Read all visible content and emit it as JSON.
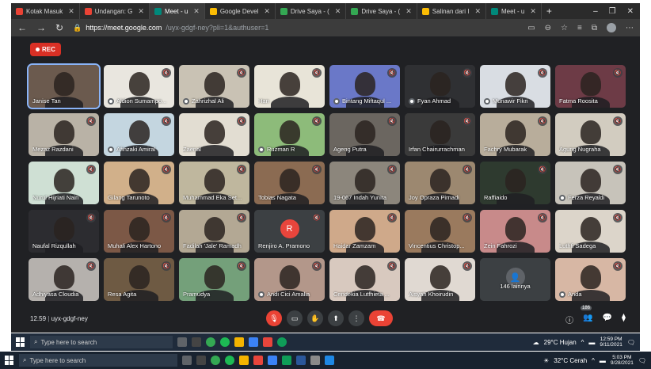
{
  "browser": {
    "tabs": [
      {
        "label": "Kotak Masuk",
        "color": "#ea4335"
      },
      {
        "label": "Undangan: G",
        "color": "#ea4335"
      },
      {
        "label": "Meet - u",
        "color": "#00897b",
        "active": true
      },
      {
        "label": "Google Devel",
        "color": "#fbbc04"
      },
      {
        "label": "Drive Saya - (",
        "color": "#34a853"
      },
      {
        "label": "Drive Saya - (",
        "color": "#34a853"
      },
      {
        "label": "Salinan dari I",
        "color": "#fbbc04"
      },
      {
        "label": "Meet - u",
        "color": "#00897b"
      }
    ],
    "url_host": "https://meet.google.com",
    "url_path": "/uyx-gdgf-ney?pli=1&authuser=1"
  },
  "meet": {
    "rec_label": "REC",
    "participants": [
      {
        "name": "Janise Tan",
        "color": "#6b5a4e",
        "active": true
      },
      {
        "name": "Aldion Sumampo...",
        "color": "#e9e6df",
        "pin": true
      },
      {
        "name": "Zahrizhal Ali",
        "color": "#c9c2b4",
        "pin": true
      },
      {
        "name": "Han",
        "color": "#e8e4d8"
      },
      {
        "name": "Bintang Miftaqul ...",
        "color": "#6a78c8",
        "pin": true
      },
      {
        "name": "Fyan Ahmad",
        "color": "#2f3033",
        "pin": true
      },
      {
        "name": "Munawir Fikri",
        "color": "#d9dde3",
        "pin": true
      },
      {
        "name": "Fatma Roosita",
        "color": "#6d3b46"
      },
      {
        "name": "Mezaz Razdani",
        "color": "#b9b2a6"
      },
      {
        "name": "Afinzaki Amiral",
        "color": "#c4d6e0",
        "pin": true
      },
      {
        "name": "Zaenal",
        "color": "#e2ddd2"
      },
      {
        "name": "Ruzman R",
        "color": "#8dbb7a",
        "pin": true
      },
      {
        "name": "Ageng Putra",
        "color": "#6b6660"
      },
      {
        "name": "Irfan Chairurrachman",
        "color": "#3a3a3a"
      },
      {
        "name": "Fachry Mubarak",
        "color": "#b8ad9b"
      },
      {
        "name": "Agung Nugraha",
        "color": "#d2ccc0"
      },
      {
        "name": "Nurul Hijriati Nain",
        "color": "#cfe0d4"
      },
      {
        "name": "Gilang Tarunoto",
        "color": "#d1b08a"
      },
      {
        "name": "Muhammad Eka Set...",
        "color": "#bfb79e"
      },
      {
        "name": "Tobias Nagata",
        "color": "#8b6b52"
      },
      {
        "name": "19-067 Indah Yunita",
        "color": "#8c867c"
      },
      {
        "name": "Joy Opraza Pirnadi",
        "color": "#9c8870"
      },
      {
        "name": "Raffiaido",
        "color": "#2e3a2f"
      },
      {
        "name": "Ferza Reyaldi",
        "color": "#c7c3ba",
        "pin": true
      },
      {
        "name": "Naufal Rizqullah",
        "color": "#2c2c30"
      },
      {
        "name": "Muhali Alex Hartono",
        "color": "#7c5846"
      },
      {
        "name": "Fadilah 'Jale' Ramadh",
        "color": "#b3a894"
      },
      {
        "name": "Renjiro A. Pramono",
        "color": "#3c4043",
        "avatar": "R"
      },
      {
        "name": "Haidar Zamzam",
        "color": "#cfa98a"
      },
      {
        "name": "Vincentius Christop...",
        "color": "#9a7a5e"
      },
      {
        "name": "Zein Fahrozi",
        "color": "#c88a8a"
      },
      {
        "name": "Luthfi Sadega",
        "color": "#dcd5ca"
      },
      {
        "name": "Adhiyasa Cloudia",
        "color": "#b5b1ad"
      },
      {
        "name": "Resa Agita",
        "color": "#6e5a43"
      },
      {
        "name": "Pramudya",
        "color": "#74a07a"
      },
      {
        "name": "Andi Cici Amalia",
        "color": "#b3978a",
        "pin": true
      },
      {
        "name": "Cendekia Lutfhieta ...",
        "color": "#d8c9bf"
      },
      {
        "name": "Aisyah Khoirudin",
        "color": "#e0d9d2"
      },
      {
        "name": "146 lainnya",
        "color": "#3c4043",
        "others": true
      },
      {
        "name": "Anda",
        "color": "#d7b7a4",
        "pin": true
      }
    ],
    "meeting_time": "12.59",
    "meeting_code": "uyx-gdgf-ney",
    "people_count": "186"
  },
  "taskbar1": {
    "search_placeholder": "Type here to search",
    "weather": "29°C Hujan",
    "time": "12:59 PM",
    "date": "9/11/2021"
  },
  "taskbar2": {
    "search_placeholder": "Type here to search",
    "weather": "32°C Cerah",
    "time": "5:03 PM",
    "date": "9/28/2021"
  }
}
